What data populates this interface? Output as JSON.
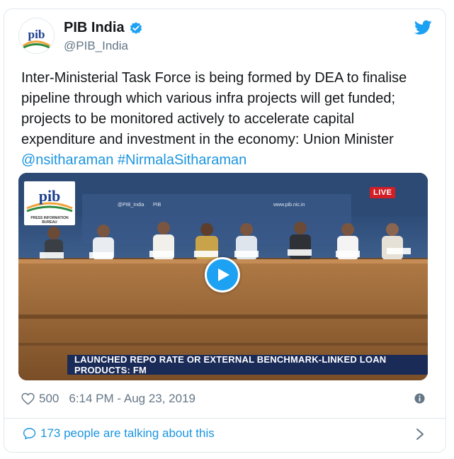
{
  "account": {
    "display_name": "PIB India",
    "handle": "@PIB_India",
    "avatar_text": "pib",
    "verified": true
  },
  "tweet": {
    "text": "Inter-Ministerial Task Force is being formed by DEA to finalise pipeline through which various infra projects will get funded; projects to be monitored actively to accelerate capital expenditure and investment in the economy: Union Minister",
    "mention": "@nsitharaman",
    "hashtag": "#NirmalaSitharaman"
  },
  "media": {
    "live_label": "LIVE",
    "logo_text": "pib",
    "logo_caption": "PRESS INFORMATION BUREAU",
    "ticker_text": "LAUNCHED REPO RATE OR EXTERNAL BENCHMARK-LINKED LOAN PRODUCTS: FM",
    "backdrop_text_1": "@PIB_India",
    "backdrop_text_2": "PIB",
    "backdrop_text_3": "www.pib.nic.in"
  },
  "footer": {
    "likes": "500",
    "timestamp": "6:14 PM - Aug 23, 2019",
    "talking_text": "173 people are talking about this"
  },
  "colors": {
    "link": "#1b95e0",
    "twitter_blue": "#1da1f2",
    "live_red": "#d21f26",
    "ticker_navy": "#1a2b58",
    "muted": "#657786"
  },
  "icons": [
    "verified-badge-icon",
    "twitter-bird-icon",
    "play-icon",
    "heart-icon",
    "info-icon",
    "comment-bubble-icon",
    "chevron-right-icon"
  ]
}
